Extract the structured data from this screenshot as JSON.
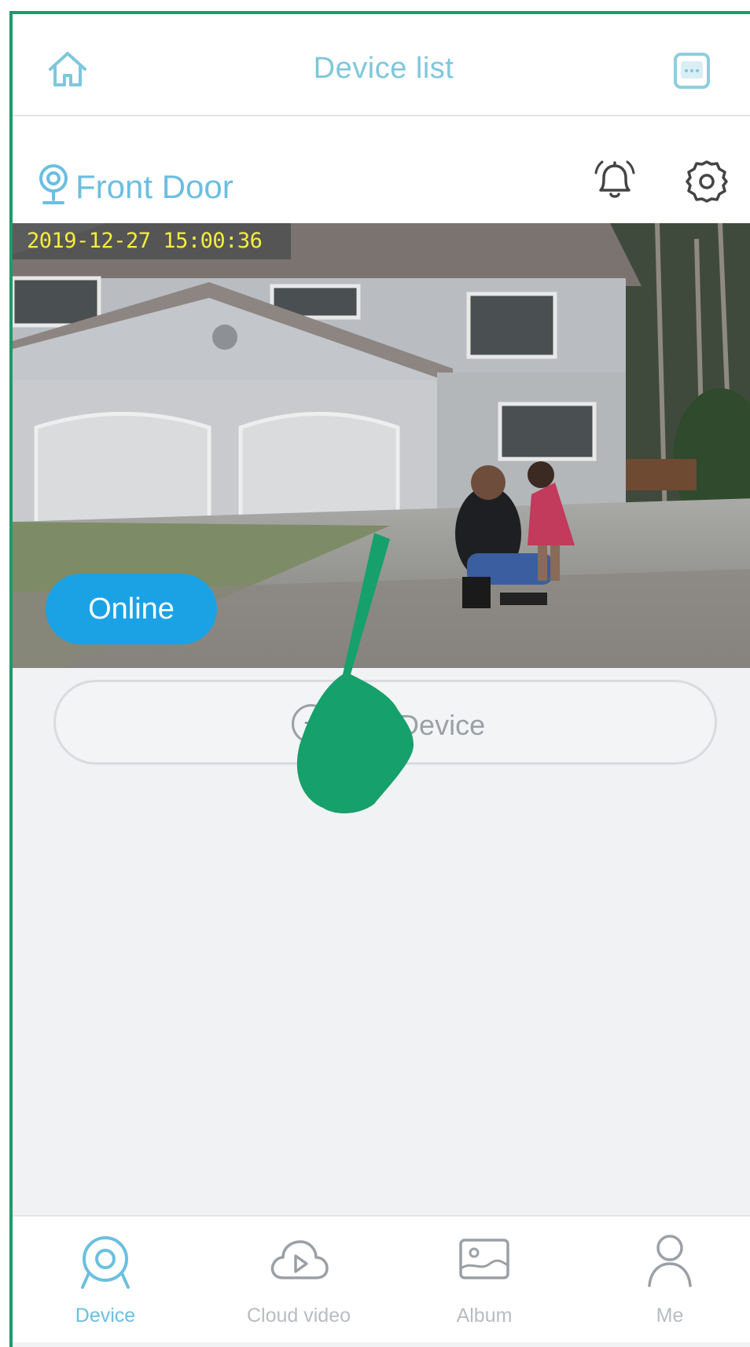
{
  "header": {
    "title": "Device list",
    "left_icon": "home-icon",
    "right_icon": "menu-icon"
  },
  "device": {
    "name": "Front Door",
    "timestamp": "2019-12-27  15:00:36",
    "status": "Online",
    "icons": [
      "camera-icon",
      "bell-icon",
      "gear-icon"
    ]
  },
  "add_device": {
    "label": "Add Device",
    "icon": "plus-icon"
  },
  "tabs": [
    {
      "label": "Device",
      "icon": "webcam-icon",
      "active": true
    },
    {
      "label": "Cloud video",
      "icon": "cloud-play-icon",
      "active": false
    },
    {
      "label": "Album",
      "icon": "image-icon",
      "active": false
    },
    {
      "label": "Me",
      "icon": "person-icon",
      "active": false
    }
  ],
  "colors": {
    "accent": "#6bbfe0",
    "online_badge": "#1ba2e5",
    "timestamp_text": "#f5ee3a",
    "frame_border": "#1e9a6a"
  }
}
